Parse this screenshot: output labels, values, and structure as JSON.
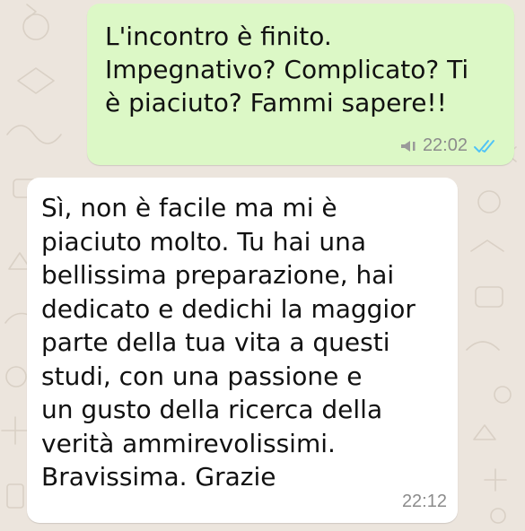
{
  "chat": {
    "background_color": "#ece5dd",
    "messages": [
      {
        "direction": "outgoing",
        "bubble_color": "#dcf8c6",
        "text": "L'incontro è finito.\nImpegnativo? Complicato? Ti\nè piaciuto? Fammi sapere!!",
        "time": "22:02",
        "status_icon": "double-check-read-icon",
        "status_color": "#4fc3f7",
        "extra_icon": "speaker-icon"
      },
      {
        "direction": "incoming",
        "bubble_color": "#ffffff",
        "text": "Sì, non è facile ma mi è\npiaciuto molto. Tu hai una\nbellissima preparazione, hai\ndedicato e dedichi la maggior\nparte della tua vita a questi\nstudi, con una passione e\nun gusto della ricerca della\nverità ammirevolissimi.\nBravissima. Grazie",
        "time": "22:12"
      }
    ]
  }
}
